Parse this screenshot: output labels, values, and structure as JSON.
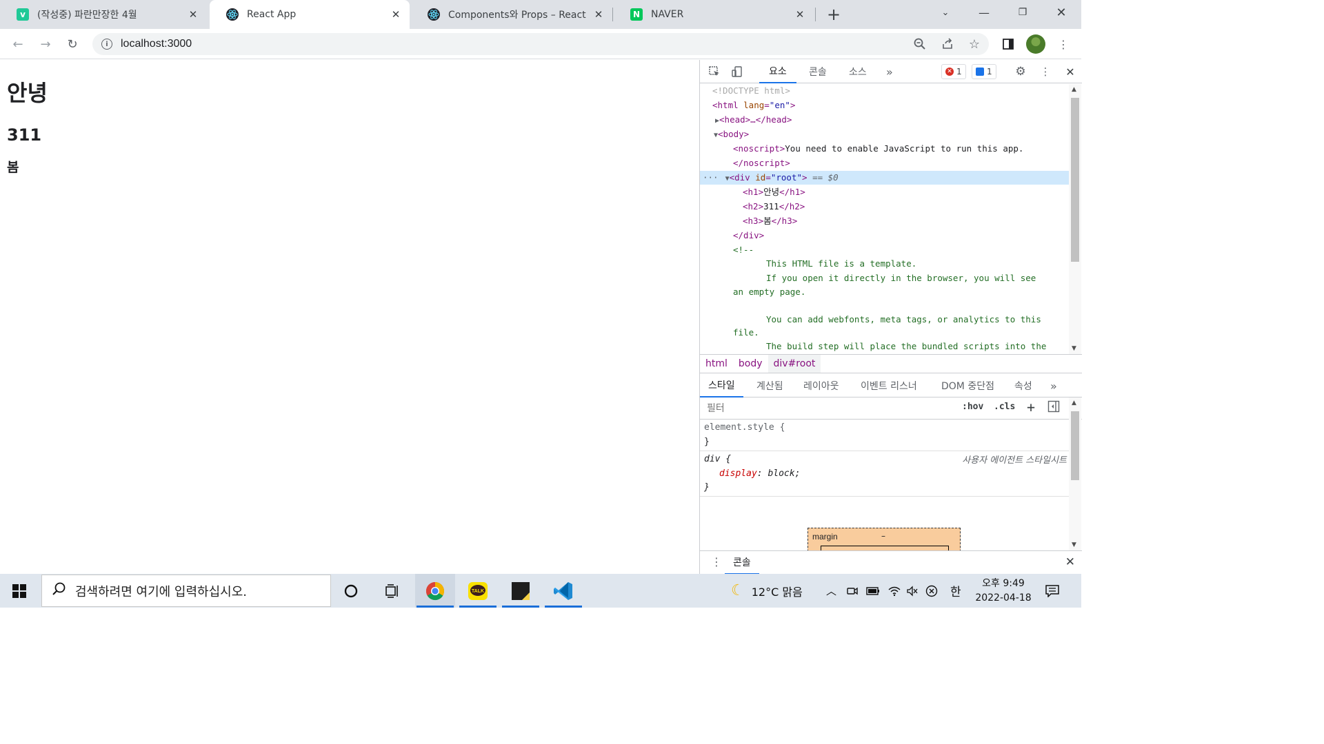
{
  "tabs": [
    {
      "title": "(작성중) 파란만장한 4월",
      "icon": "velog-icon",
      "active": false
    },
    {
      "title": "React App",
      "icon": "react-icon",
      "active": true
    },
    {
      "title": "Components와 Props – React",
      "icon": "react-icon",
      "active": false
    },
    {
      "title": "NAVER",
      "icon": "naver-icon",
      "active": false
    }
  ],
  "omnibox": {
    "url": "localhost:3000"
  },
  "page": {
    "h1": "안녕",
    "h2": "311",
    "h3": "봄"
  },
  "devtools": {
    "tabs": [
      "요소",
      "콘솔",
      "소스"
    ],
    "more": "»",
    "errors": "1",
    "messages": "1",
    "dom": {
      "doctype": "<!DOCTYPE html>",
      "html_open": "<html ",
      "html_attr": "lang",
      "html_val": "\"en\"",
      "head": "<head>…</head>",
      "body": "<body>",
      "noscript_open": "<noscript>",
      "noscript_text": "You need to enable JavaScript to run this app.",
      "noscript_close": "</noscript>",
      "div_open": "<div ",
      "div_attr": "id",
      "div_val": "\"root\"",
      "div_suffix": "== $0",
      "h1_open": "<h1>",
      "h1_text": "안녕",
      "h1_close": "</h1>",
      "h2_open": "<h2>",
      "h2_text": "311",
      "h2_close": "</h2>",
      "h3_open": "<h3>",
      "h3_text": "봄",
      "h3_close": "</h3>",
      "div_close": "</div>",
      "comment_open": "<!--",
      "comment_lines": [
        "This HTML file is a template.",
        "If you open it directly in the browser, you will see",
        "an empty page.",
        "You can add webfonts, meta tags, or analytics to this",
        "file.",
        "The build step will place the bundled scripts into the"
      ]
    },
    "breadcrumbs": [
      "html",
      "body",
      "div#root"
    ],
    "subtabs": [
      "스타일",
      "계산됨",
      "레이아웃",
      "이벤트 리스너",
      "DOM 중단점",
      "속성"
    ],
    "filter_placeholder": "필터",
    "hov": ":hov",
    "cls": ".cls",
    "styles": {
      "element_style": "element.style {",
      "close_brace": "}",
      "div_selector": "div {",
      "ua_label": "사용자 에이전트 스타일시트",
      "prop_name": "display",
      "prop_value": "block;"
    },
    "boxmodel": {
      "label": "margin",
      "value": "–"
    },
    "drawer_tab": "콘솔"
  },
  "taskbar": {
    "search_placeholder": "검색하려면 여기에 입력하십시오.",
    "weather": "12°C 맑음",
    "ime": "한",
    "time": "오후 9:49",
    "date": "2022-04-18"
  },
  "colors": {
    "accent": "#1a73e8",
    "tag": "#881280",
    "attr": "#994500",
    "value": "#1a1aa6",
    "comment": "#236e25"
  }
}
